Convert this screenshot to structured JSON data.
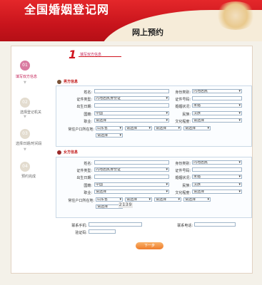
{
  "header": {
    "site_title": "全国婚姻登记网",
    "page_title": "网上预约"
  },
  "steps": [
    {
      "num": "01",
      "label": "填写双方信息"
    },
    {
      "num": "02",
      "label": "选择登记机关"
    },
    {
      "num": "03",
      "label": "选择日期/时间段"
    },
    {
      "num": "04",
      "label": "预约完成"
    }
  ],
  "step_header": {
    "num": "1",
    "label": "填写双方信息"
  },
  "male": {
    "title": "男方信息",
    "name_label": "姓名:",
    "idtype_label": "证件类型:",
    "idtype_value": "内地居民身份证",
    "birth_label": "出生日期:",
    "nation_label": "国籍:",
    "nation_value": "中国",
    "job_label": "职业:",
    "job_value": "请选择",
    "addr_label": "常住户口所在地:",
    "addr_province": "山东省",
    "addr_city": "请选择",
    "addr_county": "请选择",
    "addr_town": "请选择",
    "addr_village": "请选择",
    "identity_label": "身份类别:",
    "identity_value": "内地居民",
    "idno_label": "证件号码:",
    "marital_label": "婚姻状况:",
    "marital_value": "未婚",
    "ethnic_label": "民族:",
    "ethnic_value": "汉族",
    "edu_label": "文化程度:",
    "edu_value": "请选择"
  },
  "female": {
    "title": "女方信息",
    "name_label": "姓名:",
    "idtype_label": "证件类型:",
    "idtype_value": "内地居民身份证",
    "birth_label": "出生日期:",
    "nation_label": "国籍:",
    "nation_value": "中国",
    "job_label": "职业:",
    "job_value": "请选择",
    "addr_label": "常住户口所在地:",
    "addr_province": "山东省",
    "addr_city": "请选择",
    "addr_county": "请选择",
    "addr_town": "请选择",
    "addr_village": "请选择",
    "identity_label": "身份类别:",
    "identity_value": "内地居民",
    "idno_label": "证件号码:",
    "marital_label": "婚姻状况:",
    "marital_value": "未婚",
    "ethnic_label": "民族:",
    "ethnic_value": "汉族",
    "edu_label": "文化程度:",
    "edu_value": "请选择"
  },
  "contact": {
    "mobile_label": "联系手机:",
    "phone_label": "联系电话:",
    "captcha_label": "验证码:",
    "captcha_text": "2139"
  },
  "next_button": "下一步",
  "colors": {
    "brand_red": "#c8141c",
    "accent_pink": "#d97ba0",
    "button_orange": "#ee7c2a"
  }
}
